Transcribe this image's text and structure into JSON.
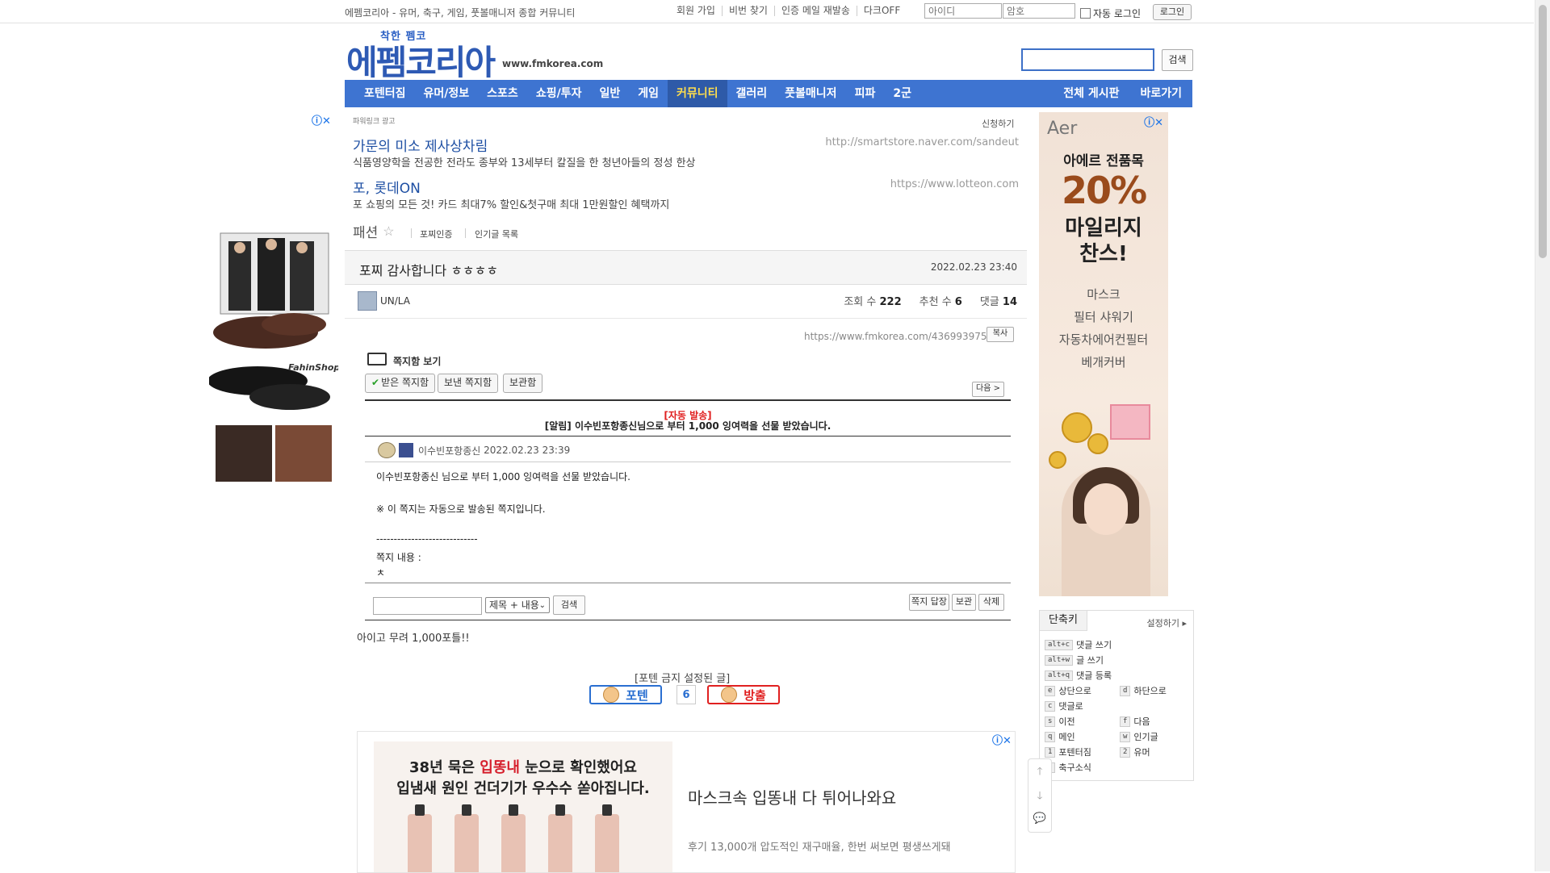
{
  "topbar": {
    "slogan": "에펨코리아 - 유머, 축구, 게임, 풋볼매니저 종합 커뮤니티",
    "links": [
      "회원 가입",
      "비번 찾기",
      "인증 메일 재발송",
      "다크OFF"
    ],
    "id_placeholder": "아이디",
    "pw_placeholder": "암호",
    "autologin_label": "자동 로그인",
    "login_label": "로그인"
  },
  "header": {
    "logo_sub": "착한 펨코",
    "logo_main": "에펨코리아",
    "logo_url": "www.fmkorea.com",
    "search_label": "검색"
  },
  "nav": {
    "items": [
      "포텐터짐",
      "유머/정보",
      "스포츠",
      "쇼핑/투자",
      "일반",
      "게임",
      "커뮤니티",
      "갤러리",
      "풋볼매니저",
      "피파",
      "2군"
    ],
    "active": "커뮤니티",
    "right": [
      "전체 게시판",
      "바로가기"
    ]
  },
  "text_ads": {
    "label": "파워링크 광고",
    "apply": "신청하기",
    "items": [
      {
        "title": "가문의 미소 제사상차림",
        "desc": "식품영양학을 전공한 전라도 종부와 13세부터 칼질을 한 청년아들의 정성 한상",
        "url": "http://smartstore.naver.com/sandeut"
      },
      {
        "title": "포, 롯데ON",
        "desc": "포 쇼핑의 모든 것! 카드 최대7% 할인&첫구매 최대 1만원할인 혜택까지",
        "url": "https://www.lotteon.com"
      }
    ]
  },
  "board": {
    "name": "패션",
    "links": [
      "포찌인증",
      "인기글 목록"
    ]
  },
  "post": {
    "title": "포찌 감사합니다 ㅎㅎㅎㅎ",
    "date": "2022.02.23 23:40",
    "author": "UN/LA",
    "views_label": "조회 수",
    "views": "222",
    "votes_label": "추천 수",
    "votes": "6",
    "comments_label": "댓글",
    "comments": "14",
    "permalink": "https://www.fmkorea.com/4369939756",
    "copy_label": "복사",
    "closing_text": "아이고 무려 1,000포틀!!"
  },
  "mailbox": {
    "title": "쪽지함 보기",
    "tabs": [
      "받은 쪽지함",
      "보낸 쪽지함",
      "보관함"
    ],
    "next_label": "다음 >",
    "auto_tag": "[자동 발송]",
    "auto_msg": "[알림] 이수빈포항종신님으로 부터 1,000 잉여력을 선물 받았습니다.",
    "sender": "이수빈포항종신",
    "sent_at": "2022.02.23 23:39",
    "body_lines": [
      "이수빈포항종신 님으로 부터 1,000 잉여력을 선물 받았습니다.",
      "※ 이 쪽지는 자동으로 발송된 쪽지입니다.",
      "-----------------------------",
      "쪽지 내용 :",
      "ㅊ"
    ],
    "select_value": "제목 + 내용",
    "search_label": "검색",
    "action_buttons": [
      "쪽지 답장",
      "보관",
      "삭제"
    ]
  },
  "vote": {
    "label": "[포텐 금지 설정된 글]",
    "up_label": "포텐",
    "count": "6",
    "down_label": "방출"
  },
  "left_ad": {
    "brand": "FahinShop"
  },
  "right_ad": {
    "brand": "Aer",
    "line1": "아에르 전품목",
    "percent": "20%",
    "line2": "마일리지",
    "line3": "찬스!",
    "items": [
      "마스크",
      "필터 샤워기",
      "자동차에어컨필터",
      "베개커버"
    ]
  },
  "bottom_ad": {
    "line1_pre": "38년 묵은 ",
    "line1_red": "입똥내",
    "line1_post": " 눈으로 확인했어요",
    "line2": "입냄새 원인 건더기가 우수수 쏟아집니다.",
    "headline": "마스크속 입똥내 다 튀어나와요",
    "desc": "후기 13,000개 압도적인 재구매율, 한번 써보면 평생쓰게돼"
  },
  "shortcuts": {
    "title": "단축키",
    "settings": "설정하기",
    "items": [
      {
        "key": "alt+c",
        "label": "댓글 쓰기"
      },
      {
        "key": "alt+w",
        "label": "글 쓰기"
      },
      {
        "key": "alt+q",
        "label": "댓글 등록"
      },
      {
        "key": "e",
        "label": "상단으로"
      },
      {
        "key": "d",
        "label": "하단으로"
      },
      {
        "key": "c",
        "label": "댓글로"
      },
      {
        "key": "s",
        "label": "이전"
      },
      {
        "key": "f",
        "label": "다음"
      },
      {
        "key": "q",
        "label": "메인"
      },
      {
        "key": "w",
        "label": "인기글"
      },
      {
        "key": "1",
        "label": "포텐터짐"
      },
      {
        "key": "2",
        "label": "유머"
      },
      {
        "key": "3",
        "label": "축구소식"
      }
    ]
  },
  "colors": {
    "nav_bg": "#3e74d1",
    "nav_active_text": "#ffde4d",
    "link_blue": "#1e4fa3",
    "alert_red": "#e02020"
  }
}
